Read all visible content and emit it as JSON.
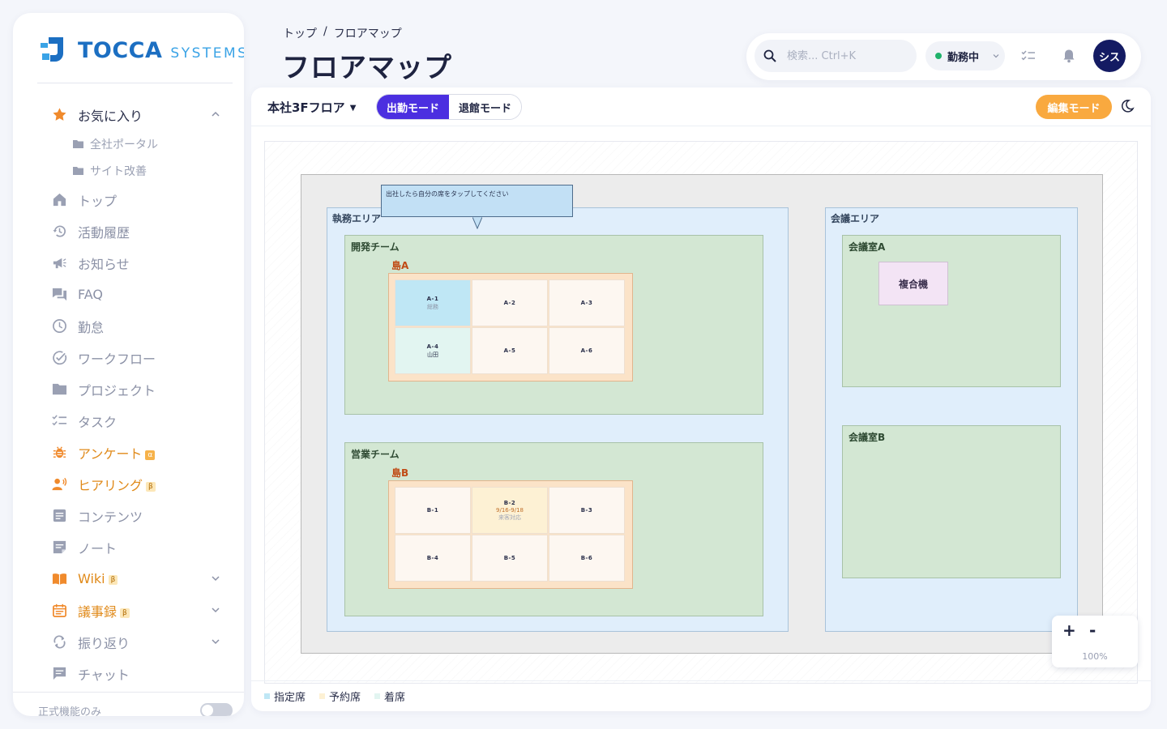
{
  "app": {
    "logo_primary": "TOCCA",
    "logo_secondary": "SYSTEMS"
  },
  "sidebar": {
    "items": [
      {
        "label": "お気に入り",
        "icon": "star-icon"
      },
      {
        "label": "全社ポータル",
        "icon": "folder-icon"
      },
      {
        "label": "サイト改善",
        "icon": "folder-icon"
      },
      {
        "label": "トップ",
        "icon": "home-icon"
      },
      {
        "label": "活動履歴",
        "icon": "history-icon"
      },
      {
        "label": "お知らせ",
        "icon": "megaphone-icon"
      },
      {
        "label": "FAQ",
        "icon": "forum-icon"
      },
      {
        "label": "勤怠",
        "icon": "clock-icon"
      },
      {
        "label": "ワークフロー",
        "icon": "check-circle-icon"
      },
      {
        "label": "プロジェクト",
        "icon": "folder-icon"
      },
      {
        "label": "タスク",
        "icon": "checklist-icon"
      },
      {
        "label": "アンケート",
        "icon": "bug-icon",
        "badge": "α"
      },
      {
        "label": "ヒアリング",
        "icon": "speaker-person-icon",
        "badge": "β"
      },
      {
        "label": "コンテンツ",
        "icon": "article-icon"
      },
      {
        "label": "ノート",
        "icon": "note-icon"
      },
      {
        "label": "Wiki",
        "icon": "book-icon",
        "badge": "β"
      },
      {
        "label": "議事録",
        "icon": "calendar-icon",
        "badge": "β"
      },
      {
        "label": "振り返り",
        "icon": "sync-icon"
      },
      {
        "label": "チャット",
        "icon": "chat-icon"
      }
    ],
    "bottom_toggle_label": "正式機能のみ"
  },
  "header": {
    "breadcrumb": [
      "トップ",
      "/",
      "フロアマップ"
    ],
    "title": "フロアマップ",
    "search_placeholder": "検索... Ctrl+K",
    "status_label": "勤務中",
    "avatar_text": "シス"
  },
  "toolbar": {
    "floor_select": "本社3Fフロア",
    "mode_attend": "出勤モード",
    "mode_leave": "退館モード",
    "edit_mode": "編集モード"
  },
  "map": {
    "tooltip": "出社したら自分の席をタップしてください",
    "areas": {
      "exec": "執務エリア",
      "meeting": "会議エリア"
    },
    "teams": {
      "dev": "開発チーム",
      "sales": "営業チーム"
    },
    "islands": {
      "a": "島A",
      "b": "島B"
    },
    "rooms": {
      "a": "会議室A",
      "b": "会議室B"
    },
    "mfp": "複合機",
    "seats_a": [
      {
        "id": "A-1",
        "sub": "総務",
        "state": "designated"
      },
      {
        "id": "A-2",
        "sub": "",
        "state": "free"
      },
      {
        "id": "A-3",
        "sub": "",
        "state": "free"
      },
      {
        "id": "A-4",
        "sub": "山田",
        "state": "present"
      },
      {
        "id": "A-5",
        "sub": "",
        "state": "free"
      },
      {
        "id": "A-6",
        "sub": "",
        "state": "free"
      }
    ],
    "seats_b": [
      {
        "id": "B-1",
        "sub": "",
        "state": "free"
      },
      {
        "id": "B-2",
        "sub": "9/16-9/18",
        "sub2": "来客対応",
        "state": "reserved"
      },
      {
        "id": "B-3",
        "sub": "",
        "state": "free"
      },
      {
        "id": "B-4",
        "sub": "",
        "state": "free"
      },
      {
        "id": "B-5",
        "sub": "",
        "state": "free"
      },
      {
        "id": "B-6",
        "sub": "",
        "state": "free"
      }
    ]
  },
  "zoom": {
    "in_label": "+",
    "out_label": "-",
    "level": "100%"
  },
  "legend": [
    {
      "label": "指定席",
      "color": "#bfe7f5"
    },
    {
      "label": "予約席",
      "color": "#fdf1d4"
    },
    {
      "label": "着席",
      "color": "#e2f5f1"
    }
  ],
  "colors": {
    "accent": "#4b2fe0",
    "edit": "#f9a93f",
    "avatar": "#141b63",
    "brand": "#1c6fc2"
  }
}
